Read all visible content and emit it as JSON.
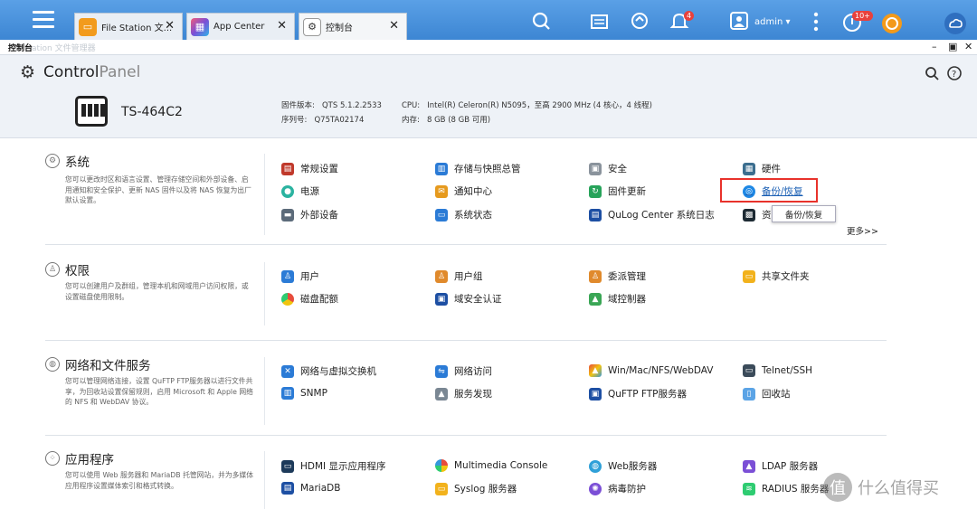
{
  "taskbar": {
    "tabs": [
      {
        "label": "File Station 文...",
        "icon": "folder-icon",
        "color": "#f29b1d"
      },
      {
        "label": "App Center",
        "icon": "app-grid-icon",
        "color": "#7b4fd6"
      },
      {
        "label": "控制台",
        "icon": "gear-icon",
        "color": "#ffffff"
      }
    ],
    "notif_count": "4",
    "user": "admin ▾",
    "update_badge": "10+"
  },
  "window": {
    "title": "控制台",
    "ghost_text": "ation 文件管理器"
  },
  "header": {
    "title_a": "Control",
    "title_b": "Panel",
    "model": "TS-464C2",
    "fw_label": "固件版本:",
    "fw_value": "QTS 5.1.2.2533",
    "sn_label": "序列号:",
    "sn_value": "Q75TA02174",
    "cpu_label": "CPU:",
    "cpu_value": "Intel(R) Celeron(R) N5095，至高 2900 MHz (4 核心，4 线程)",
    "mem_label": "内存:",
    "mem_value": "8 GB (8 GB 可用)"
  },
  "sections": {
    "system": {
      "title": "系统",
      "desc": "您可以更改时区和语言设置、管理存储空间和外部设备、启用通知和安全保护、更新 NAS 固件以及将 NAS 恢复为出厂默认设置。",
      "items": [
        "常规设置",
        "存储与快照总管",
        "安全",
        "硬件",
        "电源",
        "通知中心",
        "固件更新",
        "备份/恢复",
        "外部设备",
        "系统状态",
        "QuLog Center 系统日志",
        "资"
      ]
    },
    "privilege": {
      "title": "权限",
      "desc": "您可以创建用户及群组，管理本机和网域用户访问权限，或设置磁盘使用限制。",
      "items": [
        "用户",
        "用户组",
        "委派管理",
        "共享文件夹",
        "磁盘配额",
        "域安全认证",
        "域控制器"
      ]
    },
    "network": {
      "title": "网络和文件服务",
      "desc": "您可以管理网络连接，设置 QuFTP FTP服务器以进行文件共享，为回收站设置保留规则，启用 Microsoft 和 Apple 网络的 NFS 和 WebDAV 协议。",
      "items": [
        "网络与虚拟交换机",
        "网络访问",
        "Win/Mac/NFS/WebDAV",
        "Telnet/SSH",
        "SNMP",
        "服务发现",
        "QuFTP FTP服务器",
        "回收站"
      ]
    },
    "apps": {
      "title": "应用程序",
      "desc": "您可以使用 Web 服务器和 MariaDB 托管网站，并为多媒体应用程序设置媒体索引和格式转换。",
      "items": [
        "HDMI 显示应用程序",
        "Multimedia Console",
        "Web服务器",
        "LDAP 服务器",
        "MariaDB",
        "Syslog 服务器",
        "病毒防护",
        "RADIUS 服务器"
      ]
    }
  },
  "tooltip": "备份/恢复",
  "more": "更多>>",
  "watermark": "什么值得买",
  "colors": {
    "taskbar": "#4a90d9",
    "highlight": "#e8322b",
    "link": "#1a5fb4"
  }
}
